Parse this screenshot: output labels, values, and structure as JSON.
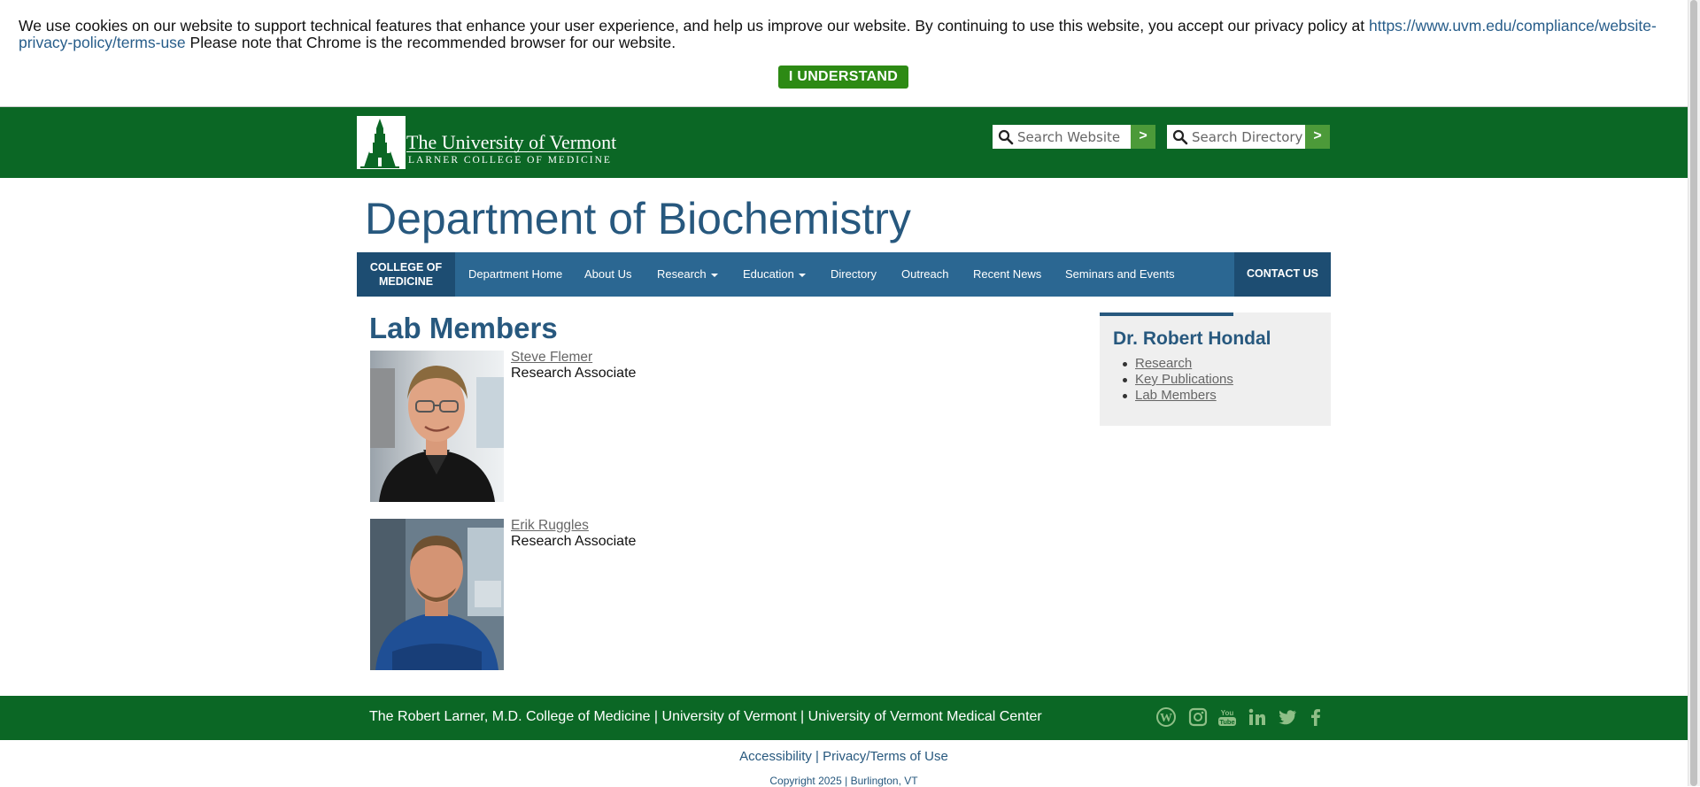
{
  "cookie_banner": {
    "text": "We use cookies on our website to support technical features that enhance your user experience, and help us improve our website. By continuing to use this website, you accept our privacy policy at ",
    "link": "https://www.uvm.edu/compliance/website-privacy-policy/terms-use",
    "text_after": " Please note that Chrome is the recommended browser for our website.",
    "button_label": "I UNDERSTAND"
  },
  "header": {
    "logo_main": "The University of Vermont",
    "logo_sub": "LARNER COLLEGE OF MEDICINE",
    "search_website_placeholder": "Search Website",
    "search_directory_placeholder": "Search Directory",
    "go_label": ">"
  },
  "department_title": "Department of Biochemistry",
  "nav": {
    "college_label": "COLLEGE OF MEDICINE",
    "items": [
      {
        "label": "Department Home"
      },
      {
        "label": "About Us"
      },
      {
        "label": "Research"
      },
      {
        "label": "Education"
      },
      {
        "label": "Directory"
      },
      {
        "label": "Outreach"
      },
      {
        "label": "Recent News"
      },
      {
        "label": "Seminars and Events"
      }
    ],
    "contact_label": "CONTACT US"
  },
  "lab": {
    "title": "Lab Members",
    "members": [
      {
        "name": "Steve Flemer",
        "role": "Research Associate"
      },
      {
        "name": "Erik Ruggles",
        "role": "Research Associate"
      }
    ]
  },
  "sidebar": {
    "title": "Dr. Robert Hondal",
    "links": [
      {
        "label": "Research"
      },
      {
        "label": "Key Publications"
      },
      {
        "label": "Lab Members "
      }
    ]
  },
  "footer": {
    "text": "The Robert Larner, M.D. College of Medicine | University of Vermont | University of Vermont Medical Center",
    "accessibility": "Accessibility",
    "separator": "|",
    "privacy": "Privacy/Terms of Use",
    "copyright": "Copyright 2025 | Burlington, VT",
    "social_icons": [
      "wordpress-icon",
      "instagram-icon",
      "youtube-icon",
      "linkedin-icon",
      "twitter-icon",
      "facebook-icon"
    ]
  },
  "colors": {
    "uvm_green": "#0b6725",
    "nav_blue": "#2b6792",
    "nav_dark": "#1d4d72",
    "title_blue": "#27587e",
    "button_green": "#2d8a14"
  }
}
